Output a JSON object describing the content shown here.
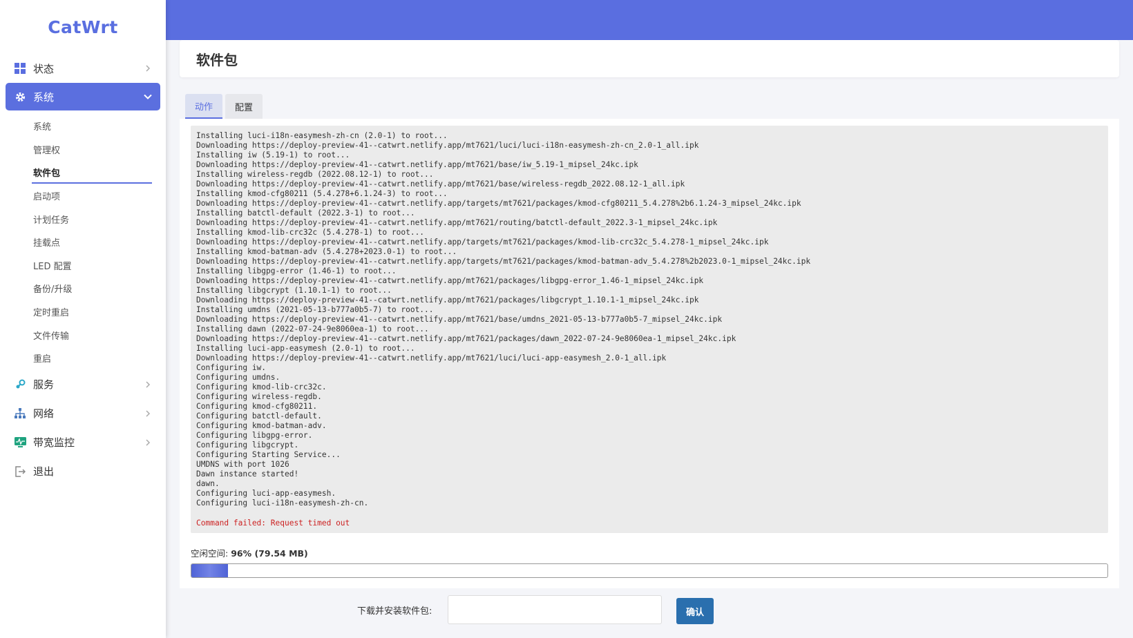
{
  "app": {
    "logo_text": "CatWrt"
  },
  "sidebar": {
    "items": [
      {
        "key": "status",
        "label": "状态",
        "icon": "dashboard-icon"
      },
      {
        "key": "system",
        "label": "系统",
        "icon": "gear-icon",
        "active": true
      },
      {
        "key": "services",
        "label": "服务",
        "icon": "puzzle-icon"
      },
      {
        "key": "network",
        "label": "网络",
        "icon": "network-icon"
      },
      {
        "key": "bandwidth",
        "label": "带宽监控",
        "icon": "monitor-icon"
      },
      {
        "key": "logout",
        "label": "退出",
        "icon": "logout-icon"
      }
    ],
    "submenu": [
      {
        "label": "系统"
      },
      {
        "label": "管理权"
      },
      {
        "label": "软件包",
        "active": true
      },
      {
        "label": "启动项"
      },
      {
        "label": "计划任务"
      },
      {
        "label": "挂载点"
      },
      {
        "label": "LED 配置"
      },
      {
        "label": "备份/升级"
      },
      {
        "label": "定时重启"
      },
      {
        "label": "文件传输"
      },
      {
        "label": "重启"
      }
    ]
  },
  "page": {
    "title": "软件包"
  },
  "tabs": [
    {
      "label": "动作",
      "active": true
    },
    {
      "label": "配置",
      "active": false
    }
  ],
  "log": {
    "lines": [
      "Installing luci-i18n-easymesh-zh-cn (2.0-1) to root...",
      "Downloading https://deploy-preview-41--catwrt.netlify.app/mt7621/luci/luci-i18n-easymesh-zh-cn_2.0-1_all.ipk",
      "Installing iw (5.19-1) to root...",
      "Downloading https://deploy-preview-41--catwrt.netlify.app/mt7621/base/iw_5.19-1_mipsel_24kc.ipk",
      "Installing wireless-regdb (2022.08.12-1) to root...",
      "Downloading https://deploy-preview-41--catwrt.netlify.app/mt7621/base/wireless-regdb_2022.08.12-1_all.ipk",
      "Installing kmod-cfg80211 (5.4.278+6.1.24-3) to root...",
      "Downloading https://deploy-preview-41--catwrt.netlify.app/targets/mt7621/packages/kmod-cfg80211_5.4.278%2b6.1.24-3_mipsel_24kc.ipk",
      "Installing batctl-default (2022.3-1) to root...",
      "Downloading https://deploy-preview-41--catwrt.netlify.app/mt7621/routing/batctl-default_2022.3-1_mipsel_24kc.ipk",
      "Installing kmod-lib-crc32c (5.4.278-1) to root...",
      "Downloading https://deploy-preview-41--catwrt.netlify.app/targets/mt7621/packages/kmod-lib-crc32c_5.4.278-1_mipsel_24kc.ipk",
      "Installing kmod-batman-adv (5.4.278+2023.0-1) to root...",
      "Downloading https://deploy-preview-41--catwrt.netlify.app/targets/mt7621/packages/kmod-batman-adv_5.4.278%2b2023.0-1_mipsel_24kc.ipk",
      "Installing libgpg-error (1.46-1) to root...",
      "Downloading https://deploy-preview-41--catwrt.netlify.app/mt7621/packages/libgpg-error_1.46-1_mipsel_24kc.ipk",
      "Installing libgcrypt (1.10.1-1) to root...",
      "Downloading https://deploy-preview-41--catwrt.netlify.app/mt7621/packages/libgcrypt_1.10.1-1_mipsel_24kc.ipk",
      "Installing umdns (2021-05-13-b777a0b5-7) to root...",
      "Downloading https://deploy-preview-41--catwrt.netlify.app/mt7621/base/umdns_2021-05-13-b777a0b5-7_mipsel_24kc.ipk",
      "Installing dawn (2022-07-24-9e8060ea-1) to root...",
      "Downloading https://deploy-preview-41--catwrt.netlify.app/mt7621/packages/dawn_2022-07-24-9e8060ea-1_mipsel_24kc.ipk",
      "Installing luci-app-easymesh (2.0-1) to root...",
      "Downloading https://deploy-preview-41--catwrt.netlify.app/mt7621/luci/luci-app-easymesh_2.0-1_all.ipk",
      "Configuring iw.",
      "Configuring umdns.",
      "Configuring kmod-lib-crc32c.",
      "Configuring wireless-regdb.",
      "Configuring kmod-cfg80211.",
      "Configuring batctl-default.",
      "Configuring kmod-batman-adv.",
      "Configuring libgpg-error.",
      "Configuring libgcrypt.",
      "Configuring Starting Service...",
      "UMDNS with port 1026",
      "Dawn instance started!",
      "dawn.",
      "Configuring luci-app-easymesh.",
      "Configuring luci-i18n-easymesh-zh-cn."
    ],
    "error": "Command failed: Request timed out"
  },
  "storage": {
    "label": "空闲空间:",
    "value": "96% (79.54 MB)",
    "used_percent": 4
  },
  "install": {
    "label": "下载并安装软件包:",
    "placeholder": "",
    "button_label": "确认"
  }
}
